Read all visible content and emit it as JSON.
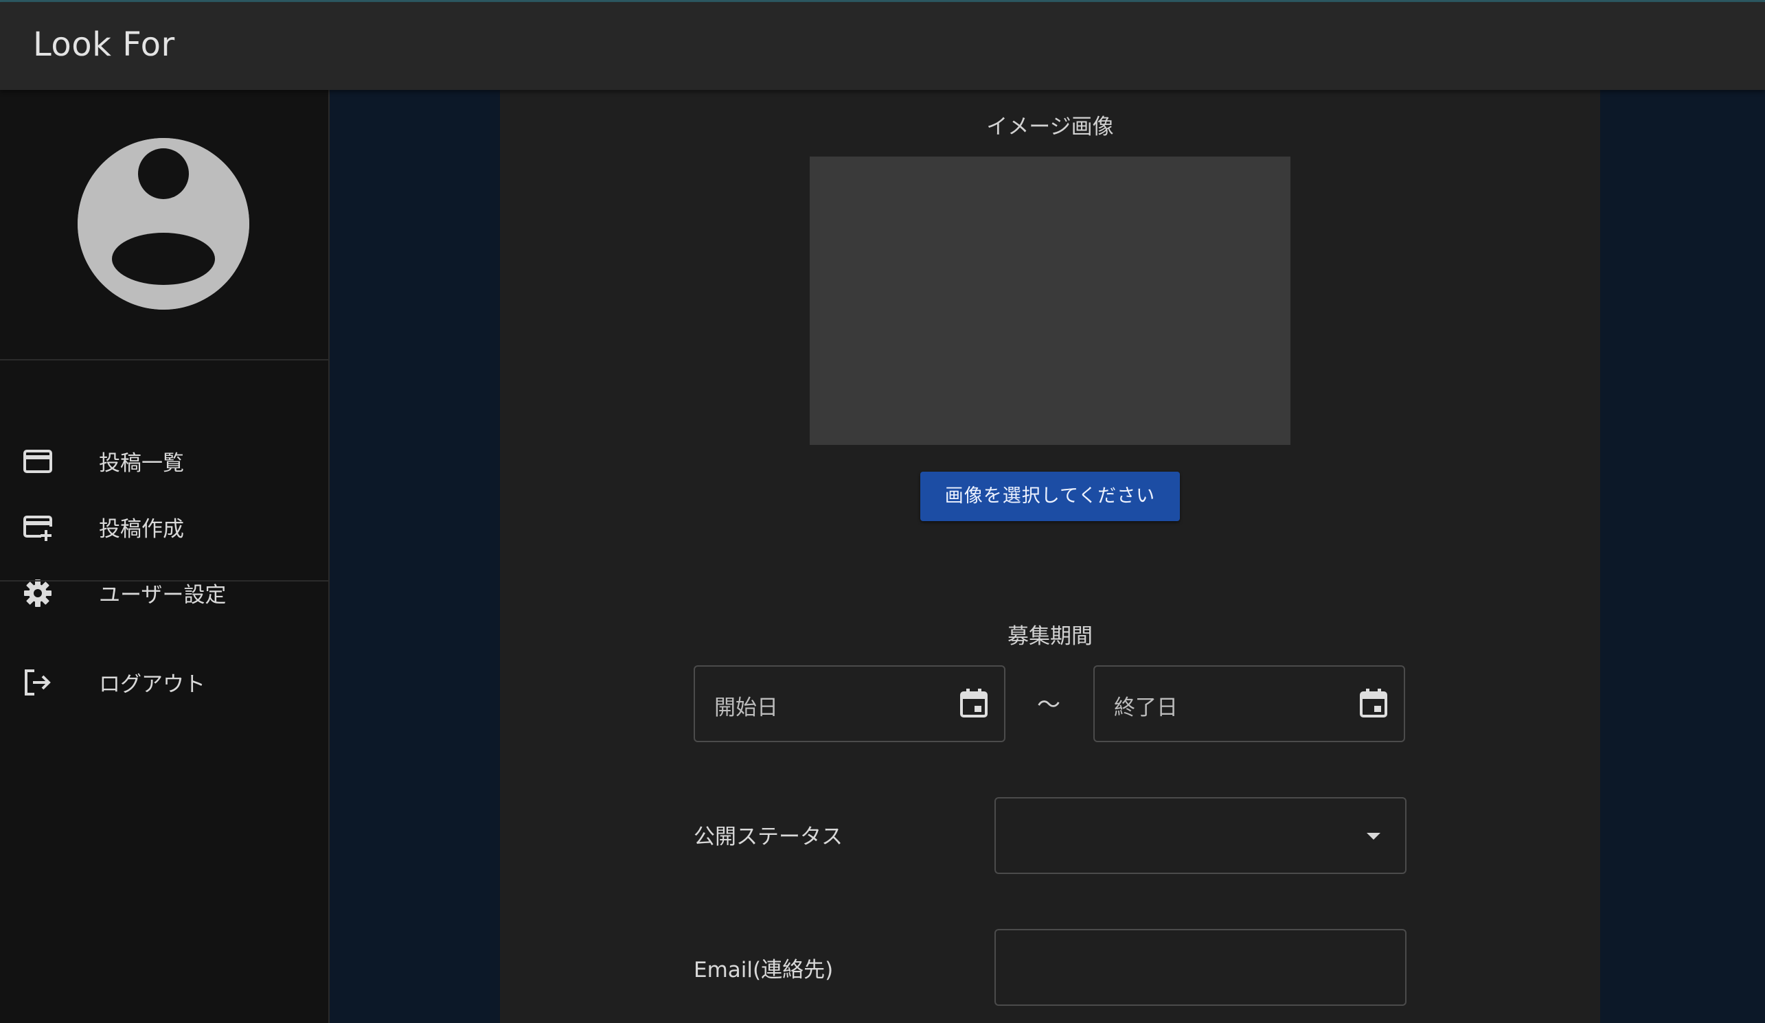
{
  "app": {
    "title": "Look For"
  },
  "sidebar": {
    "items": [
      {
        "label": "投稿一覧",
        "icon": "card-icon"
      },
      {
        "label": "投稿作成",
        "icon": "card-plus-icon"
      },
      {
        "label": "ユーザー設定",
        "icon": "gear-icon"
      },
      {
        "label": "ログアウト",
        "icon": "logout-icon"
      }
    ]
  },
  "form": {
    "image_section_label": "イメージ画像",
    "select_image_button": "画像を選択してください",
    "period_label": "募集期間",
    "start_date_placeholder": "開始日",
    "range_separator": "〜",
    "end_date_placeholder": "終了日",
    "status_label": "公開ステータス",
    "status_value": "",
    "email_label": "Email(連絡先)",
    "email_value": ""
  },
  "colors": {
    "appbar": "#272727",
    "sidebar": "#121212",
    "page_background": "#0c1828",
    "content_panel": "#1f1f1f",
    "image_placeholder": "#3a3a3a",
    "primary_button": "#1c4da4",
    "avatar": "#bdbdbd"
  }
}
